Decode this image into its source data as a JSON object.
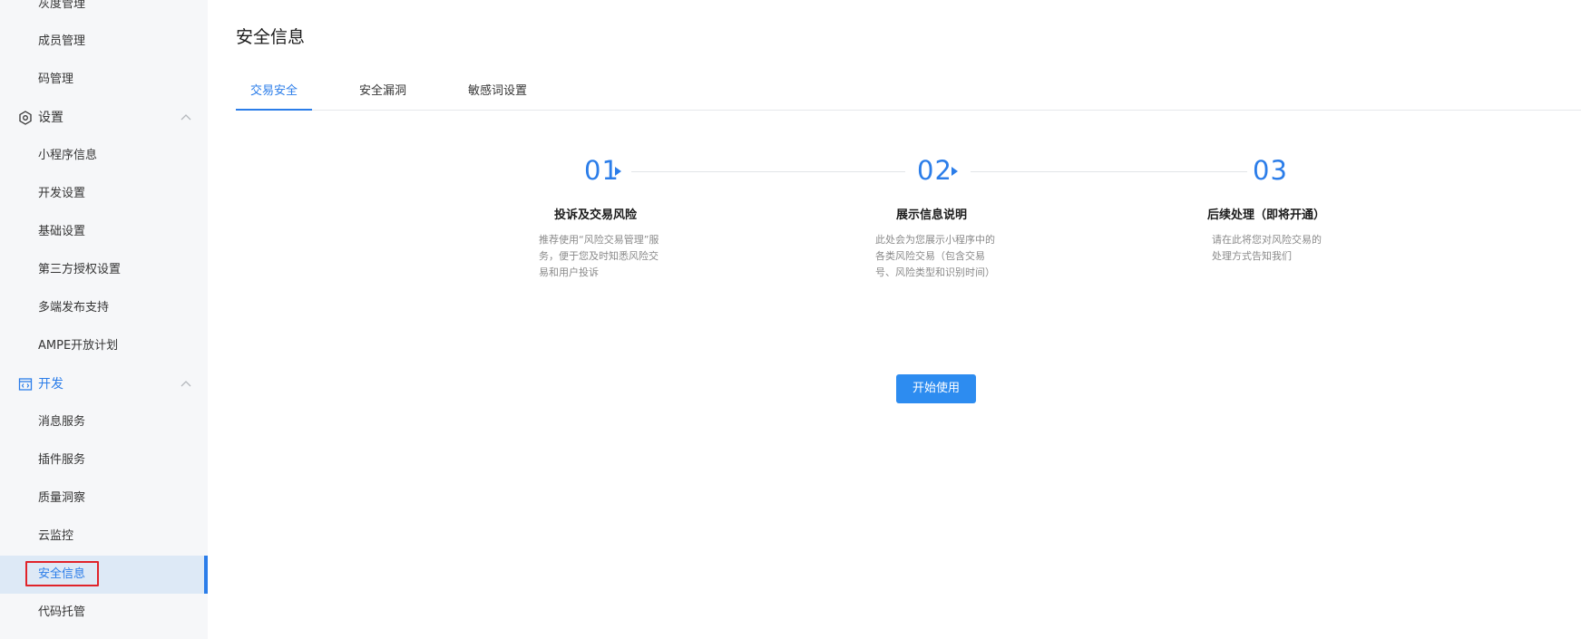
{
  "sidebar": {
    "items": [
      {
        "label": "灰度管理"
      },
      {
        "label": "成员管理"
      },
      {
        "label": "码管理"
      },
      {
        "label": "设置"
      },
      {
        "label": "小程序信息"
      },
      {
        "label": "开发设置"
      },
      {
        "label": "基础设置"
      },
      {
        "label": "第三方授权设置"
      },
      {
        "label": "多端发布支持"
      },
      {
        "label": "AMPE开放计划"
      },
      {
        "label": "开发"
      },
      {
        "label": "消息服务"
      },
      {
        "label": "插件服务"
      },
      {
        "label": "质量洞察"
      },
      {
        "label": "云监控"
      },
      {
        "label": "安全信息"
      },
      {
        "label": "代码托管"
      }
    ]
  },
  "main": {
    "title": "安全信息",
    "tabs": [
      {
        "label": "交易安全"
      },
      {
        "label": "安全漏洞"
      },
      {
        "label": "敏感词设置"
      }
    ],
    "steps": [
      {
        "num": "01",
        "title": "投诉及交易风险",
        "desc": [
          "推荐使用“风险交易管理”服",
          "务，便于您及时知悉风险交",
          "易和用户投诉"
        ]
      },
      {
        "num": "02",
        "title": "展示信息说明",
        "desc": [
          "此处会为您展示小程序中的",
          "各类风险交易（包含交易",
          "号、风险类型和识别时间）"
        ]
      },
      {
        "num": "03",
        "title": "后续处理（即将开通）",
        "desc": [
          "请在此将您对风险交易的",
          "处理方式告知我们"
        ]
      }
    ],
    "start_button": "开始使用"
  },
  "colors": {
    "accent": "#2b7de9",
    "button": "#2d8cf0",
    "highlight_border": "#e0232a",
    "sidebar_bg": "#f6f7f9"
  }
}
